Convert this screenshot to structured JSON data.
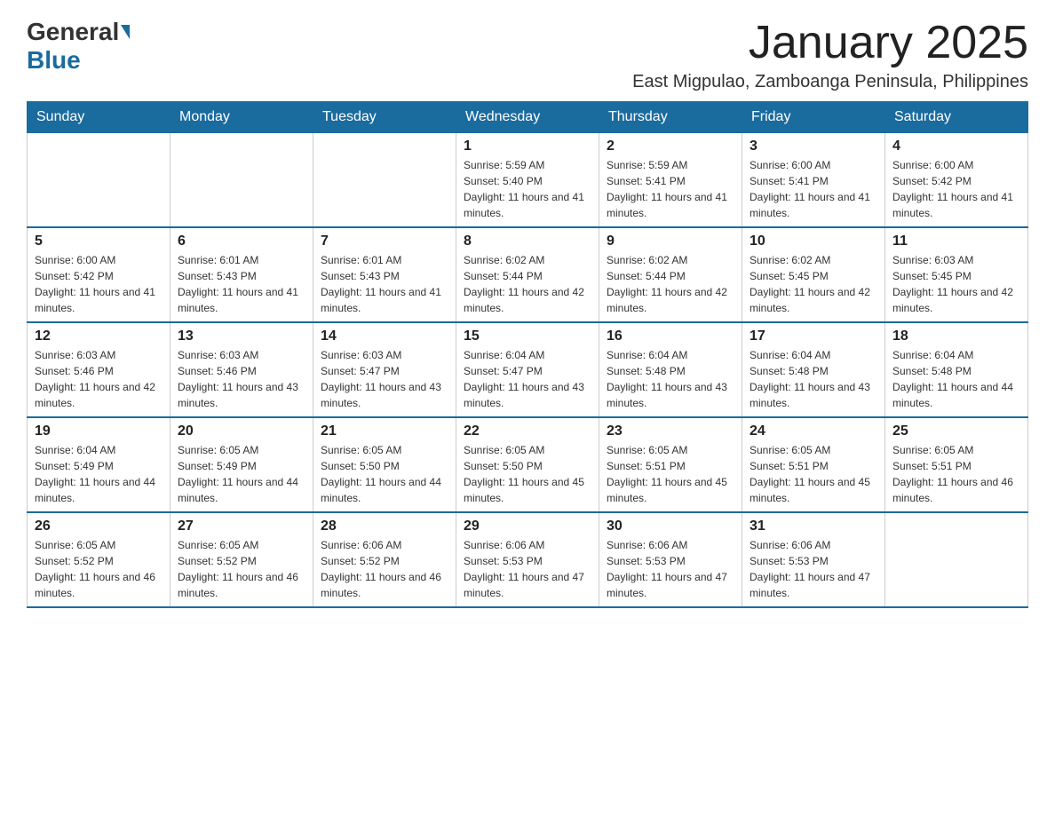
{
  "logo": {
    "text_general": "General",
    "text_blue": "Blue"
  },
  "header": {
    "month_title": "January 2025",
    "subtitle": "East Migpulao, Zamboanga Peninsula, Philippines"
  },
  "weekdays": [
    "Sunday",
    "Monday",
    "Tuesday",
    "Wednesday",
    "Thursday",
    "Friday",
    "Saturday"
  ],
  "weeks": [
    [
      {
        "day": "",
        "info": ""
      },
      {
        "day": "",
        "info": ""
      },
      {
        "day": "",
        "info": ""
      },
      {
        "day": "1",
        "info": "Sunrise: 5:59 AM\nSunset: 5:40 PM\nDaylight: 11 hours and 41 minutes."
      },
      {
        "day": "2",
        "info": "Sunrise: 5:59 AM\nSunset: 5:41 PM\nDaylight: 11 hours and 41 minutes."
      },
      {
        "day": "3",
        "info": "Sunrise: 6:00 AM\nSunset: 5:41 PM\nDaylight: 11 hours and 41 minutes."
      },
      {
        "day": "4",
        "info": "Sunrise: 6:00 AM\nSunset: 5:42 PM\nDaylight: 11 hours and 41 minutes."
      }
    ],
    [
      {
        "day": "5",
        "info": "Sunrise: 6:00 AM\nSunset: 5:42 PM\nDaylight: 11 hours and 41 minutes."
      },
      {
        "day": "6",
        "info": "Sunrise: 6:01 AM\nSunset: 5:43 PM\nDaylight: 11 hours and 41 minutes."
      },
      {
        "day": "7",
        "info": "Sunrise: 6:01 AM\nSunset: 5:43 PM\nDaylight: 11 hours and 41 minutes."
      },
      {
        "day": "8",
        "info": "Sunrise: 6:02 AM\nSunset: 5:44 PM\nDaylight: 11 hours and 42 minutes."
      },
      {
        "day": "9",
        "info": "Sunrise: 6:02 AM\nSunset: 5:44 PM\nDaylight: 11 hours and 42 minutes."
      },
      {
        "day": "10",
        "info": "Sunrise: 6:02 AM\nSunset: 5:45 PM\nDaylight: 11 hours and 42 minutes."
      },
      {
        "day": "11",
        "info": "Sunrise: 6:03 AM\nSunset: 5:45 PM\nDaylight: 11 hours and 42 minutes."
      }
    ],
    [
      {
        "day": "12",
        "info": "Sunrise: 6:03 AM\nSunset: 5:46 PM\nDaylight: 11 hours and 42 minutes."
      },
      {
        "day": "13",
        "info": "Sunrise: 6:03 AM\nSunset: 5:46 PM\nDaylight: 11 hours and 43 minutes."
      },
      {
        "day": "14",
        "info": "Sunrise: 6:03 AM\nSunset: 5:47 PM\nDaylight: 11 hours and 43 minutes."
      },
      {
        "day": "15",
        "info": "Sunrise: 6:04 AM\nSunset: 5:47 PM\nDaylight: 11 hours and 43 minutes."
      },
      {
        "day": "16",
        "info": "Sunrise: 6:04 AM\nSunset: 5:48 PM\nDaylight: 11 hours and 43 minutes."
      },
      {
        "day": "17",
        "info": "Sunrise: 6:04 AM\nSunset: 5:48 PM\nDaylight: 11 hours and 43 minutes."
      },
      {
        "day": "18",
        "info": "Sunrise: 6:04 AM\nSunset: 5:48 PM\nDaylight: 11 hours and 44 minutes."
      }
    ],
    [
      {
        "day": "19",
        "info": "Sunrise: 6:04 AM\nSunset: 5:49 PM\nDaylight: 11 hours and 44 minutes."
      },
      {
        "day": "20",
        "info": "Sunrise: 6:05 AM\nSunset: 5:49 PM\nDaylight: 11 hours and 44 minutes."
      },
      {
        "day": "21",
        "info": "Sunrise: 6:05 AM\nSunset: 5:50 PM\nDaylight: 11 hours and 44 minutes."
      },
      {
        "day": "22",
        "info": "Sunrise: 6:05 AM\nSunset: 5:50 PM\nDaylight: 11 hours and 45 minutes."
      },
      {
        "day": "23",
        "info": "Sunrise: 6:05 AM\nSunset: 5:51 PM\nDaylight: 11 hours and 45 minutes."
      },
      {
        "day": "24",
        "info": "Sunrise: 6:05 AM\nSunset: 5:51 PM\nDaylight: 11 hours and 45 minutes."
      },
      {
        "day": "25",
        "info": "Sunrise: 6:05 AM\nSunset: 5:51 PM\nDaylight: 11 hours and 46 minutes."
      }
    ],
    [
      {
        "day": "26",
        "info": "Sunrise: 6:05 AM\nSunset: 5:52 PM\nDaylight: 11 hours and 46 minutes."
      },
      {
        "day": "27",
        "info": "Sunrise: 6:05 AM\nSunset: 5:52 PM\nDaylight: 11 hours and 46 minutes."
      },
      {
        "day": "28",
        "info": "Sunrise: 6:06 AM\nSunset: 5:52 PM\nDaylight: 11 hours and 46 minutes."
      },
      {
        "day": "29",
        "info": "Sunrise: 6:06 AM\nSunset: 5:53 PM\nDaylight: 11 hours and 47 minutes."
      },
      {
        "day": "30",
        "info": "Sunrise: 6:06 AM\nSunset: 5:53 PM\nDaylight: 11 hours and 47 minutes."
      },
      {
        "day": "31",
        "info": "Sunrise: 6:06 AM\nSunset: 5:53 PM\nDaylight: 11 hours and 47 minutes."
      },
      {
        "day": "",
        "info": ""
      }
    ]
  ]
}
